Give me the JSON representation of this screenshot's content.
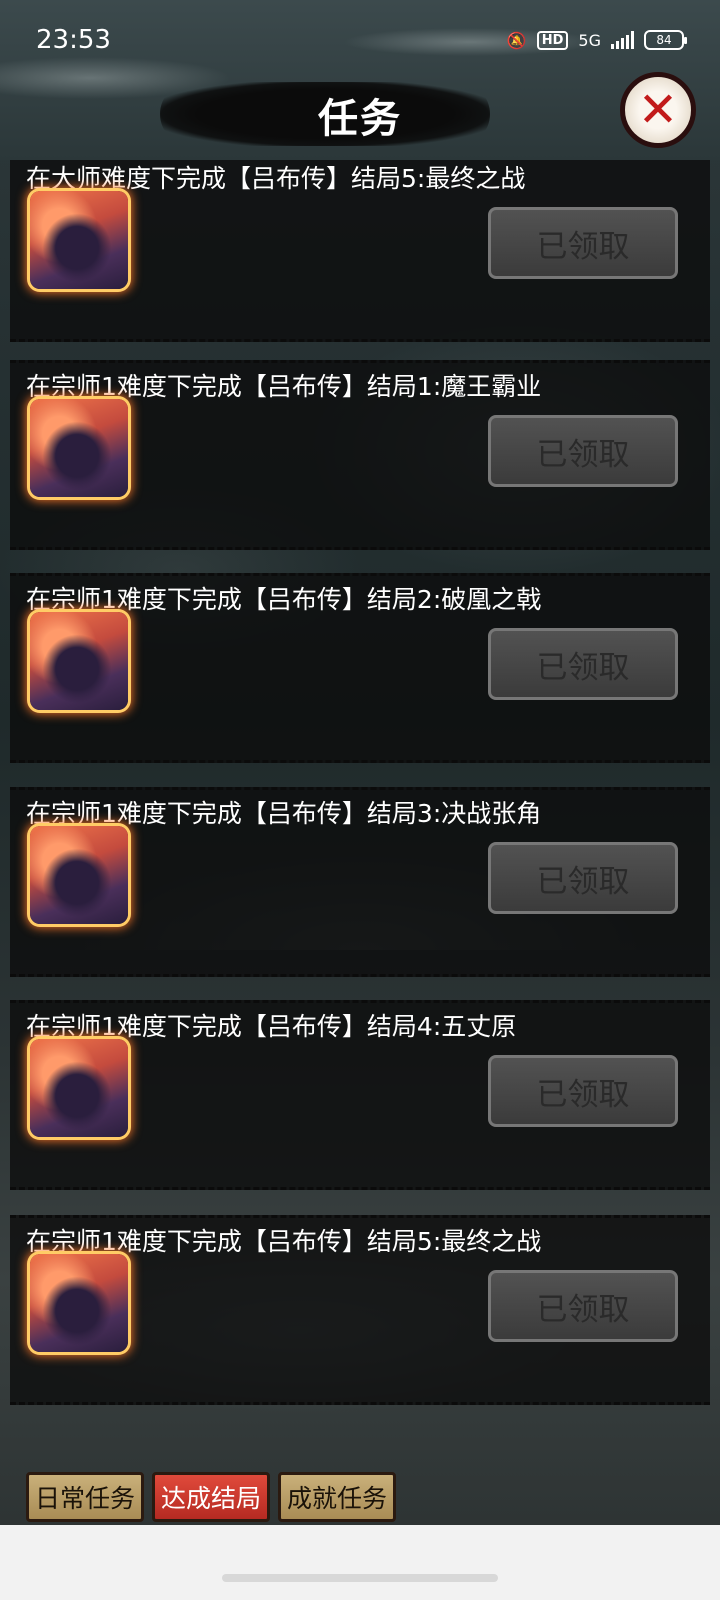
{
  "status_bar": {
    "time": "23:53",
    "hd": "HD",
    "network": "5G",
    "battery": "84",
    "icons": [
      "mute-bell-icon",
      "signal-icon",
      "battery-icon"
    ]
  },
  "header": {
    "title": "任务",
    "close_icon": "close-x-icon"
  },
  "tasks": [
    {
      "text": "在大师难度下完成【吕布传】结局5:最终之战",
      "button": "已领取"
    },
    {
      "text": "在宗师1难度下完成【吕布传】结局1:魔王霸业",
      "button": "已领取"
    },
    {
      "text": "在宗师1难度下完成【吕布传】结局2:破凰之戟",
      "button": "已领取"
    },
    {
      "text": "在宗师1难度下完成【吕布传】结局3:决战张角",
      "button": "已领取"
    },
    {
      "text": "在宗师1难度下完成【吕布传】结局4:五丈原",
      "button": "已领取"
    },
    {
      "text": "在宗师1难度下完成【吕布传】结局5:最终之战",
      "button": "已领取"
    }
  ],
  "tabs": [
    {
      "label": "日常任务",
      "active": false
    },
    {
      "label": "达成结局",
      "active": true
    },
    {
      "label": "成就任务",
      "active": false
    }
  ]
}
